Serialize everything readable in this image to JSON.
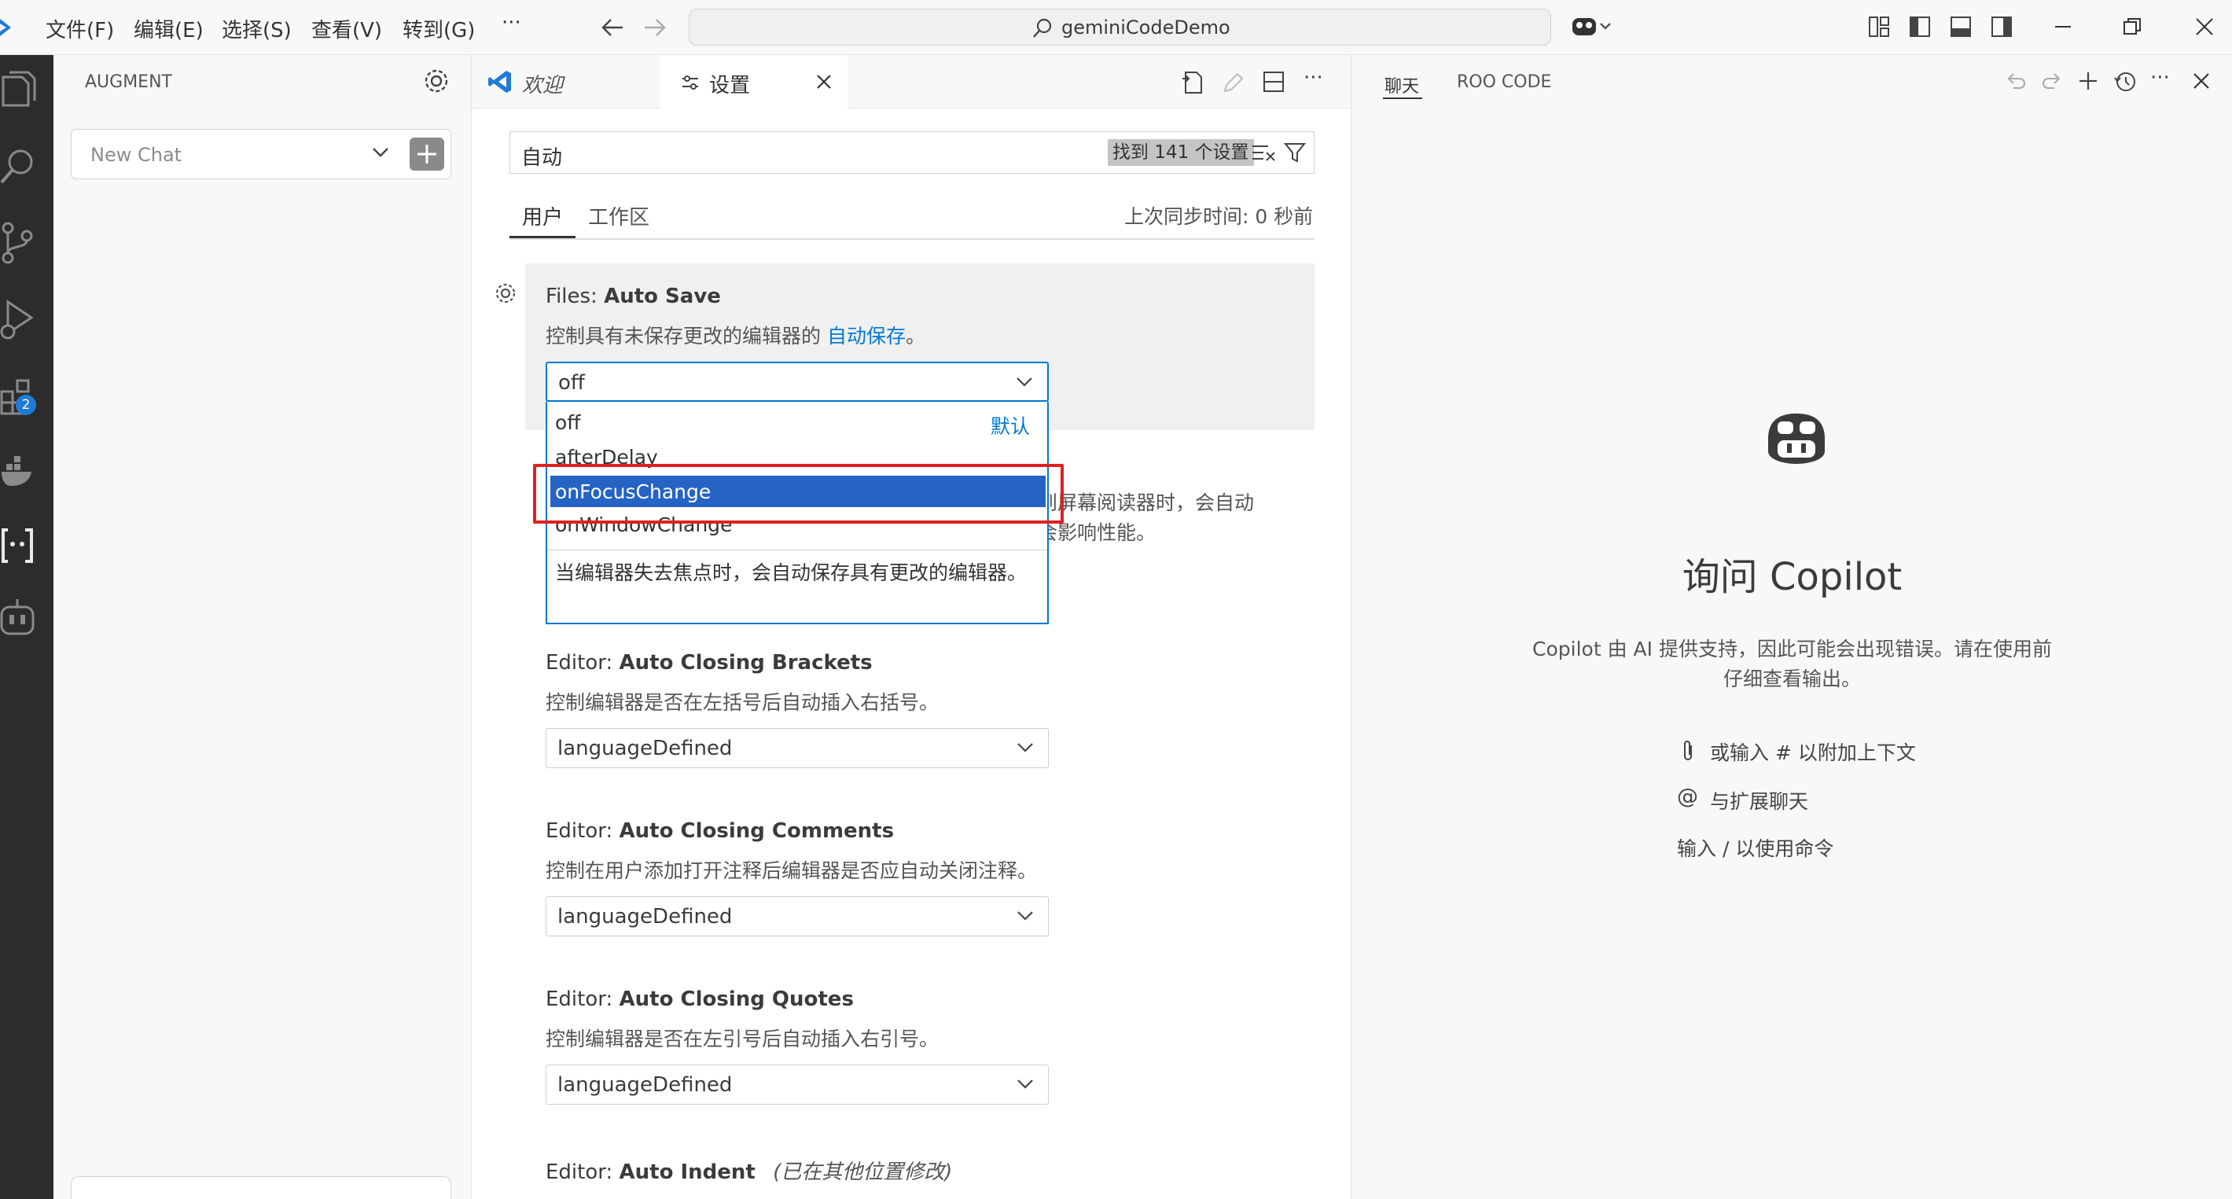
{
  "menu": [
    "文件(F)",
    "编辑(E)",
    "选择(S)",
    "查看(V)",
    "转到(G)",
    "···"
  ],
  "command_center": "geminiCodeDemo",
  "activity_badge": "2",
  "sidebar": {
    "title": "AUGMENT",
    "chat_select": "New Chat"
  },
  "tabs": [
    {
      "label": "欢迎"
    },
    {
      "label": "设置"
    }
  ],
  "settings": {
    "search_value": "自动",
    "result_count": "找到 141 个设置",
    "scope_tabs": [
      "用户",
      "工作区"
    ],
    "sync_status": "上次同步时间: 0 秒前",
    "auto_save": {
      "prefix": "Files: ",
      "name": "Auto Save",
      "desc_text": "控制具有未保存更改的编辑器的 ",
      "desc_link": "自动保存",
      "desc_end": "。",
      "value": "off",
      "options": [
        "off",
        "afterDelay",
        "onFocusChange",
        "onWindowChange"
      ],
      "default_label": "默认",
      "option_help": "当编辑器失去焦点时，会自动保存具有更改的编辑器。"
    },
    "hidden_partial_text_1": "到屏幕阅读器时，会自动",
    "hidden_partial_text_2": "会影响性能。",
    "closing_brackets": {
      "prefix": "Editor: ",
      "name": "Auto Closing Brackets",
      "desc": "控制编辑器是否在左括号后自动插入右括号。",
      "value": "languageDefined"
    },
    "closing_comments": {
      "prefix": "Editor: ",
      "name": "Auto Closing Comments",
      "desc": "控制在用户添加打开注释后编辑器是否应自动关闭注释。",
      "value": "languageDefined"
    },
    "closing_quotes": {
      "prefix": "Editor: ",
      "name": "Auto Closing Quotes",
      "desc": "控制编辑器是否在左引号后自动插入右引号。",
      "value": "languageDefined"
    },
    "auto_indent": {
      "prefix": "Editor: ",
      "name": "Auto Indent",
      "modified": "(已在其他位置修改)"
    }
  },
  "right_panel": {
    "tabs": [
      "聊天",
      "ROO CODE"
    ],
    "title": "询问 Copilot",
    "subtitle_line1": "Copilot 由 AI 提供支持，因此可能会出现错误。请在使用前",
    "subtitle_line2": "仔细查看输出。",
    "hints": [
      "或输入 # 以附加上下文",
      "与扩展聊天",
      "输入 / 以使用命令"
    ],
    "hint_symbol_at": "@"
  },
  "colors": {
    "accent": "#0078d4",
    "highlight_red": "#e02020",
    "selected_option": "#2563c4",
    "activity_bar": "#2c2c2c"
  }
}
